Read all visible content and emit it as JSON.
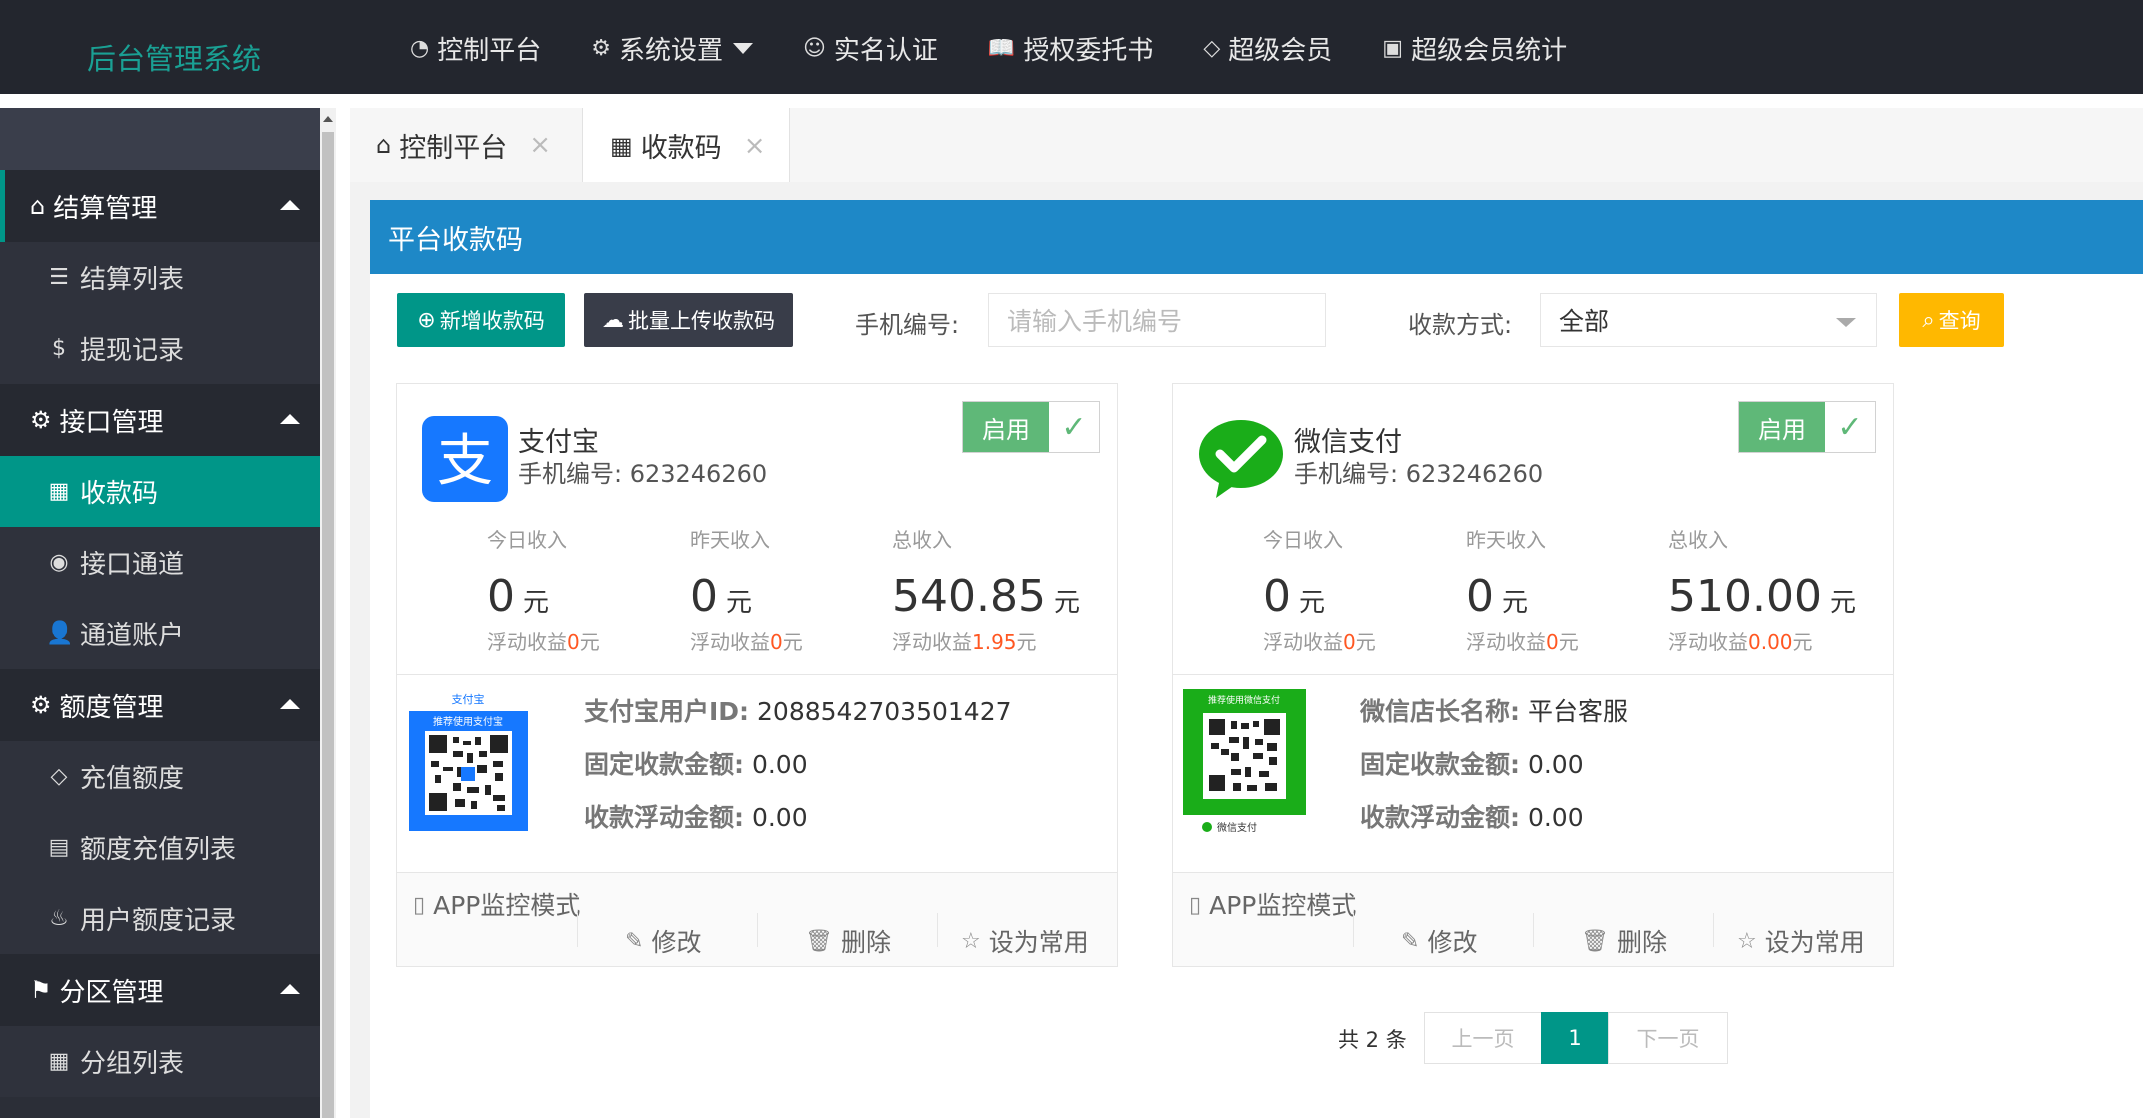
{
  "app": {
    "title": "后台管理系统"
  },
  "topnav": [
    {
      "icon": "◔",
      "label": "控制平台"
    },
    {
      "icon": "⚙",
      "label": "系统设置"
    },
    {
      "icon": "☺",
      "label": "实名认证"
    },
    {
      "icon": "📖",
      "label": "授权委托书"
    },
    {
      "icon": "◇",
      "label": "超级会员"
    },
    {
      "icon": "▣",
      "label": "超级会员统计"
    }
  ],
  "sidebar": {
    "groups": [
      {
        "icon": "⌂",
        "label": "结算管理",
        "items": [
          {
            "icon": "☰",
            "label": "结算列表"
          },
          {
            "icon": "$",
            "label": "提现记录"
          }
        ]
      },
      {
        "icon": "⚙",
        "label": "接口管理",
        "items": [
          {
            "icon": "▦",
            "label": "收款码",
            "active": true
          },
          {
            "icon": "◉",
            "label": "接口通道"
          },
          {
            "icon": "👤",
            "label": "通道账户"
          }
        ]
      },
      {
        "icon": "⚙",
        "label": "额度管理",
        "items": [
          {
            "icon": "◇",
            "label": "充值额度"
          },
          {
            "icon": "▤",
            "label": "额度充值列表"
          },
          {
            "icon": "♨",
            "label": "用户额度记录"
          }
        ]
      },
      {
        "icon": "⚑",
        "label": "分区管理",
        "items": [
          {
            "icon": "▦",
            "label": "分组列表"
          }
        ]
      }
    ]
  },
  "tabs": [
    {
      "icon": "⌂",
      "label": "控制平台",
      "close": "×"
    },
    {
      "icon": "▦",
      "label": "收款码",
      "close": "×"
    }
  ],
  "panel": {
    "title": "平台收款码"
  },
  "toolbar": {
    "add_label": "新增收款码",
    "upload_label": "批量上传收款码",
    "phone_label": "手机编号:",
    "phone_placeholder": "请输入手机编号",
    "method_label": "收款方式:",
    "method_value": "全部",
    "query_label": "查询"
  },
  "cards": [
    {
      "name": "支付宝",
      "phone": "手机编号:  623246260",
      "status": "启用",
      "today_label": "今日收入",
      "today_value": "0",
      "today_unit": "元",
      "today_float_prefix": "浮动收益",
      "today_float": "0",
      "today_float_suffix": "元",
      "yest_label": "昨天收入",
      "yest_value": "0",
      "yest_unit": "元",
      "yest_float_prefix": "浮动收益",
      "yest_float": "0",
      "yest_float_suffix": "元",
      "total_label": "总收入",
      "total_value": "540.85",
      "total_unit": "元",
      "total_float_prefix": "浮动收益",
      "total_float": "1.95",
      "total_float_suffix": "元",
      "info1_key": "支付宝用户ID:",
      "info1_val": "2088542703501427",
      "info2_key": "固定收款金额:",
      "info2_val": "0.00",
      "info3_key": "收款浮动金额:",
      "info3_val": "0.00",
      "mode": "APP监控模式",
      "edit": "修改",
      "delete": "删除",
      "favorite": "设为常用",
      "qr_title": "支付宝",
      "qr_caption": "推荐使用支付宝"
    },
    {
      "name": "微信支付",
      "phone": "手机编号:  623246260",
      "status": "启用",
      "today_label": "今日收入",
      "today_value": "0",
      "today_unit": "元",
      "today_float_prefix": "浮动收益",
      "today_float": "0",
      "today_float_suffix": "元",
      "yest_label": "昨天收入",
      "yest_value": "0",
      "yest_unit": "元",
      "yest_float_prefix": "浮动收益",
      "yest_float": "0",
      "yest_float_suffix": "元",
      "total_label": "总收入",
      "total_value": "510.00",
      "total_unit": "元",
      "total_float_prefix": "浮动收益",
      "total_float": "0.00",
      "total_float_suffix": "元",
      "info1_key": "微信店长名称:",
      "info1_val": "平台客服",
      "info2_key": "固定收款金额:",
      "info2_val": "0.00",
      "info3_key": "收款浮动金额:",
      "info3_val": "0.00",
      "mode": "APP监控模式",
      "edit": "修改",
      "delete": "删除",
      "favorite": "设为常用",
      "qr_title": "推荐使用微信支付",
      "qr_caption": "微信支付"
    }
  ],
  "pager": {
    "total": "共 2 条",
    "prev": "上一页",
    "current": "1",
    "next": "下一页"
  },
  "colors": {
    "accent": "#009688",
    "topbar": "#23262e",
    "panel_head": "#1e88c7",
    "warn": "#ffb800",
    "enabled": "#5fb878",
    "highlight": "#ff5722"
  }
}
